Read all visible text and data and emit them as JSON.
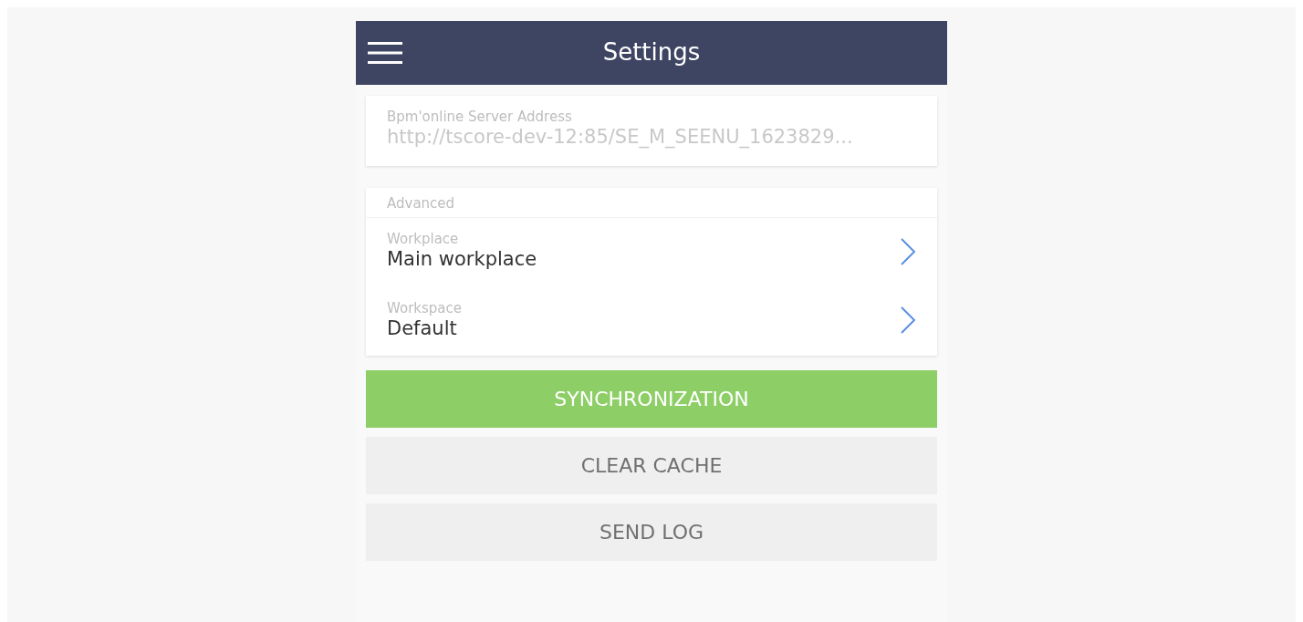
{
  "header": {
    "title": "Settings"
  },
  "server": {
    "label": "Bpm'online Server Address",
    "value": "http://tscore-dev-12:85/SE_M_SEENU_1623829...",
    "disabled": true
  },
  "advanced": {
    "title": "Advanced",
    "items": [
      {
        "label": "Workplace",
        "value": "Main workplace"
      },
      {
        "label": "Workspace",
        "value": "Default"
      }
    ]
  },
  "buttons": [
    {
      "label": "SYNCHRONIZATION",
      "kind": "primary"
    },
    {
      "label": "CLEAR CACHE",
      "kind": "secondary"
    },
    {
      "label": "SEND LOG",
      "kind": "secondary"
    }
  ]
}
